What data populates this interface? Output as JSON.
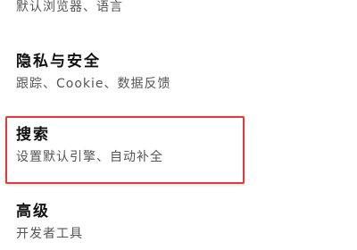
{
  "settings": {
    "partial_item": {
      "subtitle": "默认浏览器、语言"
    },
    "items": [
      {
        "title": "隐私与安全",
        "subtitle": "跟踪、Cookie、数据反馈"
      },
      {
        "title": "搜索",
        "subtitle": "设置默认引擎、自动补全"
      },
      {
        "title": "高级",
        "subtitle": "开发者工具"
      }
    ]
  },
  "highlight": {
    "color": "#e03a3a",
    "target": "搜索"
  }
}
